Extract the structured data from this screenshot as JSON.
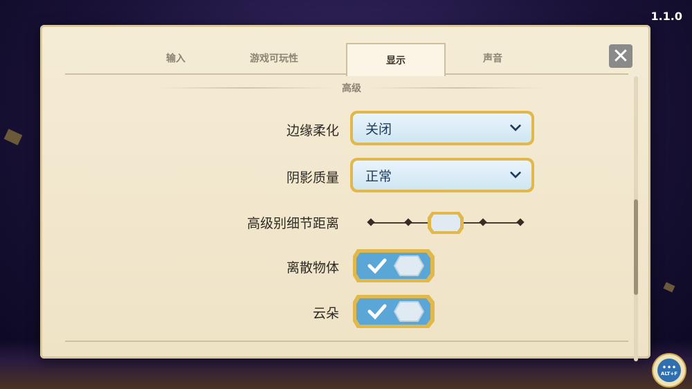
{
  "version": "1.1.0",
  "tabs": [
    {
      "label": "输入"
    },
    {
      "label": "游戏可玩性"
    },
    {
      "label": "显示"
    },
    {
      "label": "声音"
    }
  ],
  "active_tab": "显示",
  "section_title": "高级",
  "settings": {
    "antialiasing": {
      "label": "边缘柔化",
      "value": "关闭"
    },
    "shadow_quality": {
      "label": "阴影质量",
      "value": "正常"
    },
    "lod_distance": {
      "label": "高级别细节距离",
      "level": 3,
      "steps": 5
    },
    "scattered_objects": {
      "label": "离散物体",
      "checked": true
    },
    "clouds": {
      "label": "云朵",
      "checked": true
    }
  },
  "chat_button": {
    "hotkey": "ALT+F"
  },
  "colors": {
    "panel": "#f5ecd6",
    "gold": "#e2b84a",
    "toggle_blue": "#5aa6d6",
    "field_blue": "#cfe6f3"
  }
}
